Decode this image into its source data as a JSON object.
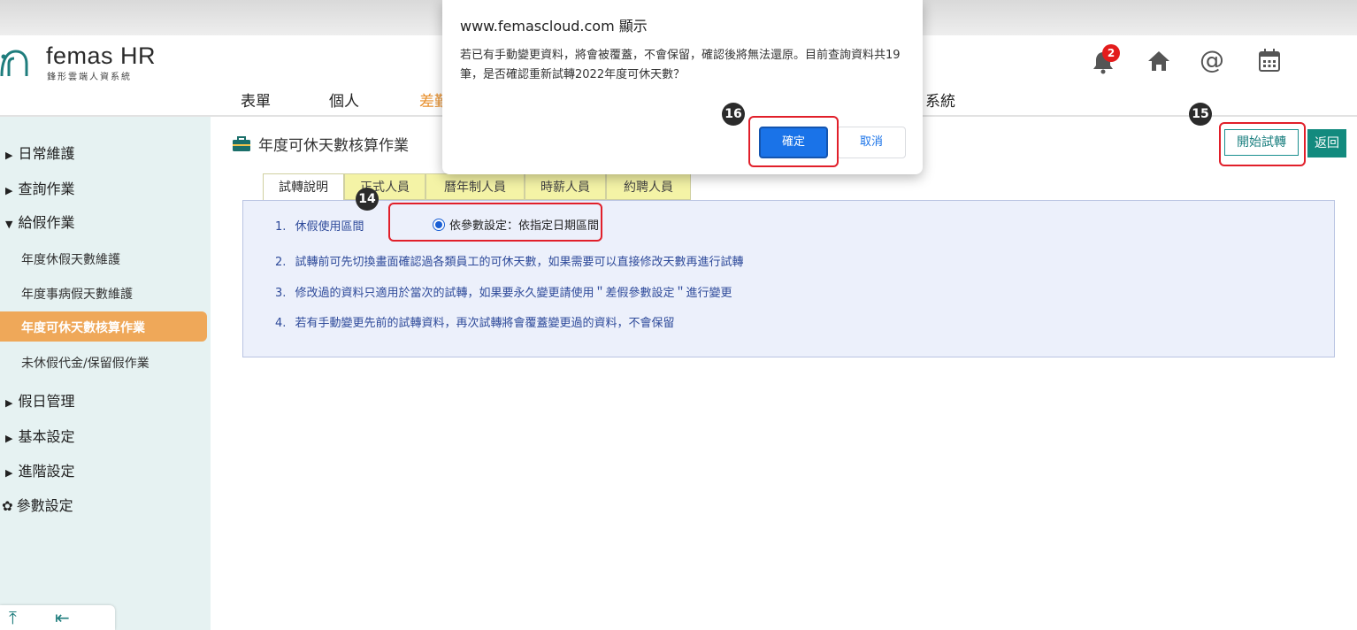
{
  "browser": {
    "dialog": {
      "title": "www.femascloud.com 顯示",
      "message": "若已有手動變更資料，將會被覆蓋，不會保留，確認後將無法還原。目前查詢資料共19筆，是否確認重新試轉2022年度可休天數？",
      "ok_label": "確定",
      "cancel_label": "取消"
    }
  },
  "header": {
    "logo_title": "femas HR",
    "logo_subtitle": "鋒形雲端人資系統",
    "nav": [
      "表單",
      "個人",
      "差勤",
      "系統"
    ],
    "active_nav": "差勤",
    "notification_count": "2",
    "icons": [
      "bell-icon",
      "home-icon",
      "at-icon",
      "calendar-icon"
    ]
  },
  "sidebar": {
    "items": [
      {
        "label": "日常維護",
        "type": "collapsed"
      },
      {
        "label": "查詢作業",
        "type": "collapsed"
      },
      {
        "label": "給假作業",
        "type": "expanded"
      },
      {
        "label": "年度休假天數維護",
        "type": "sub"
      },
      {
        "label": "年度事病假天數維護",
        "type": "sub"
      },
      {
        "label": "年度可休天數核算作業",
        "type": "sub-active"
      },
      {
        "label": "未休假代金/保留假作業",
        "type": "sub"
      },
      {
        "label": "假日管理",
        "type": "collapsed"
      },
      {
        "label": "基本設定",
        "type": "collapsed"
      },
      {
        "label": "進階設定",
        "type": "collapsed"
      },
      {
        "label": "參數設定",
        "type": "gear"
      }
    ]
  },
  "main": {
    "page_title": "年度可休天數核算作業",
    "buttons": {
      "start": "開始試轉",
      "back": "返回"
    },
    "tabs": [
      "試轉說明",
      "正式人員",
      "曆年制人員",
      "時薪人員",
      "約聘人員"
    ],
    "active_tab": "試轉說明",
    "lines": [
      {
        "num": "1.",
        "text": "休假使用區間"
      },
      {
        "num": "2.",
        "text": "試轉前可先切換畫面確認過各類員工的可休天數，如果需要可以直接修改天數再進行試轉"
      },
      {
        "num": "3.",
        "text": "修改過的資料只適用於當次的試轉，如果要永久變更請使用＂差假參數設定＂進行變更"
      },
      {
        "num": "4.",
        "text": "若有手動變更先前的試轉資料，再次試轉將會覆蓋變更過的資料，不會保留"
      }
    ],
    "radio_label": "依參數設定：依指定日期區間"
  },
  "annotations": {
    "m14": "14",
    "m15": "15",
    "m16": "16"
  },
  "colors": {
    "accent": "#e8902e",
    "teal": "#128a7e",
    "highlight": "#e11f2a",
    "dialog_ok": "#1a73e8"
  }
}
